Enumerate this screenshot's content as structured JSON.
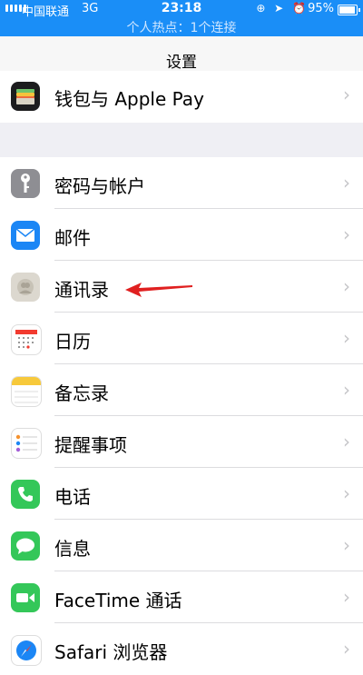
{
  "status_bar": {
    "carrier": "中国联通",
    "network": "3G",
    "time": "23:18",
    "battery_percent": "95%",
    "battery_level": 0.95,
    "hotspot_text": "个人热点：1个连接"
  },
  "navbar": {
    "title": "设置"
  },
  "top_item": {
    "label": "钱包与 Apple Pay",
    "icon": "wallet-icon"
  },
  "items": [
    {
      "label": "密码与帐户",
      "icon": "key-icon"
    },
    {
      "label": "邮件",
      "icon": "mail-icon"
    },
    {
      "label": "通讯录",
      "icon": "contacts-icon"
    },
    {
      "label": "日历",
      "icon": "calendar-icon"
    },
    {
      "label": "备忘录",
      "icon": "notes-icon"
    },
    {
      "label": "提醒事项",
      "icon": "reminders-icon"
    },
    {
      "label": "电话",
      "icon": "phone-icon"
    },
    {
      "label": "信息",
      "icon": "messages-icon"
    },
    {
      "label": "FaceTime 通话",
      "icon": "facetime-icon"
    },
    {
      "label": "Safari 浏览器",
      "icon": "safari-icon"
    }
  ],
  "colors": {
    "status_bar": "#1a8ef7",
    "annotation_arrow": "#e02020"
  }
}
